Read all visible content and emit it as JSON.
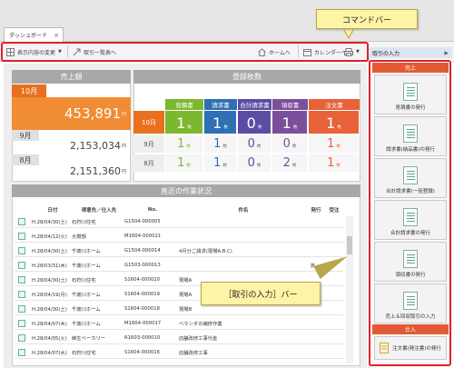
{
  "tab": {
    "label": "ダッシュボード",
    "close": "×"
  },
  "toolbar": {
    "change_view": "表示内容の変更",
    "transactions": "取引一覧表へ",
    "home": "ホームへ",
    "calendar": "カレンダーへ"
  },
  "callouts": {
    "command_bar": "コマンドバー",
    "transaction_bar": "［取引の入力］バー"
  },
  "sidebar": {
    "title": "取引の入力",
    "sales_section": "売上",
    "buttons": [
      "見積書の発行",
      "請求書(納品書)の発行",
      "合計請求書(一括登録)",
      "合計請求書の発行",
      "領収書の発行",
      "売上＆回収取引の入力"
    ],
    "purchase_section": "仕入",
    "order_button": "注文書(発注書)の発行"
  },
  "sales": {
    "title": "売上額",
    "months": [
      {
        "label": "10月",
        "value": "453,891",
        "unit": "円"
      },
      {
        "label": "9月",
        "value": "2,153,034",
        "unit": "円"
      },
      {
        "label": "8月",
        "value": "2,151,360",
        "unit": "円"
      }
    ]
  },
  "docs": {
    "title": "登録枚数",
    "headers": [
      "見積書",
      "請求書",
      "合計請求書",
      "領収書",
      "注文書"
    ],
    "header_colors": [
      "#7cb82f",
      "#2f6fb3",
      "#5b4da3",
      "#7a4f9b",
      "#e8623a"
    ],
    "unit": "枚",
    "rows": [
      {
        "month": "10月",
        "values": [
          "1",
          "1",
          "0",
          "1",
          "1"
        ]
      },
      {
        "month": "9月",
        "values": [
          "1",
          "1",
          "0",
          "0",
          "1"
        ]
      },
      {
        "month": "8月",
        "values": [
          "1",
          "1",
          "0",
          "2",
          "1"
        ]
      }
    ]
  },
  "activity": {
    "title": "直近の作業状況",
    "headers": [
      "日付",
      "得意先／仕入先",
      "No.",
      "件名",
      "発行",
      "受注"
    ],
    "rows": [
      {
        "date": "H.28/04/30(土)",
        "party": "石狩川住宅",
        "no": "G1504-000005",
        "subject": "",
        "issued": ""
      },
      {
        "date": "H.28/04/12(火)",
        "party": "大樹部",
        "no": "M1604-000021",
        "subject": "",
        "issued": ""
      },
      {
        "date": "H.28/04/30(土)",
        "party": "千歳川ホーム",
        "no": "G1504-000014",
        "subject": "4月分ご請求(現場A.B.C)",
        "issued": ""
      },
      {
        "date": "H.28/03/31(木)",
        "party": "千歳川ホーム",
        "no": "G1503-000013",
        "subject": "",
        "issued": "済"
      },
      {
        "date": "H.28/04/30(土)",
        "party": "石狩川住宅",
        "no": "S1604-000020",
        "subject": "現場A",
        "issued": ""
      },
      {
        "date": "H.28/04/19(月)",
        "party": "千歳川ホーム",
        "no": "S1604-000019",
        "subject": "現場A",
        "issued": ""
      },
      {
        "date": "H.28/04/30(土)",
        "party": "千歳川ホーム",
        "no": "S1604-000018",
        "subject": "現場B",
        "issued": ""
      },
      {
        "date": "H.28/04/07(木)",
        "party": "千歳川ホーム",
        "no": "M1604-000017",
        "subject": "ベランダの補修作業",
        "issued": ""
      },
      {
        "date": "H.28/04/05(火)",
        "party": "麻生ベーカリー",
        "no": "R1603-000010",
        "subject": "店舗改修工事代金",
        "issued": ""
      },
      {
        "date": "H.28/04/07(水)",
        "party": "石狩川住宅",
        "no": "S1604-000016",
        "subject": "店舗改修工事",
        "issued": ""
      }
    ]
  }
}
